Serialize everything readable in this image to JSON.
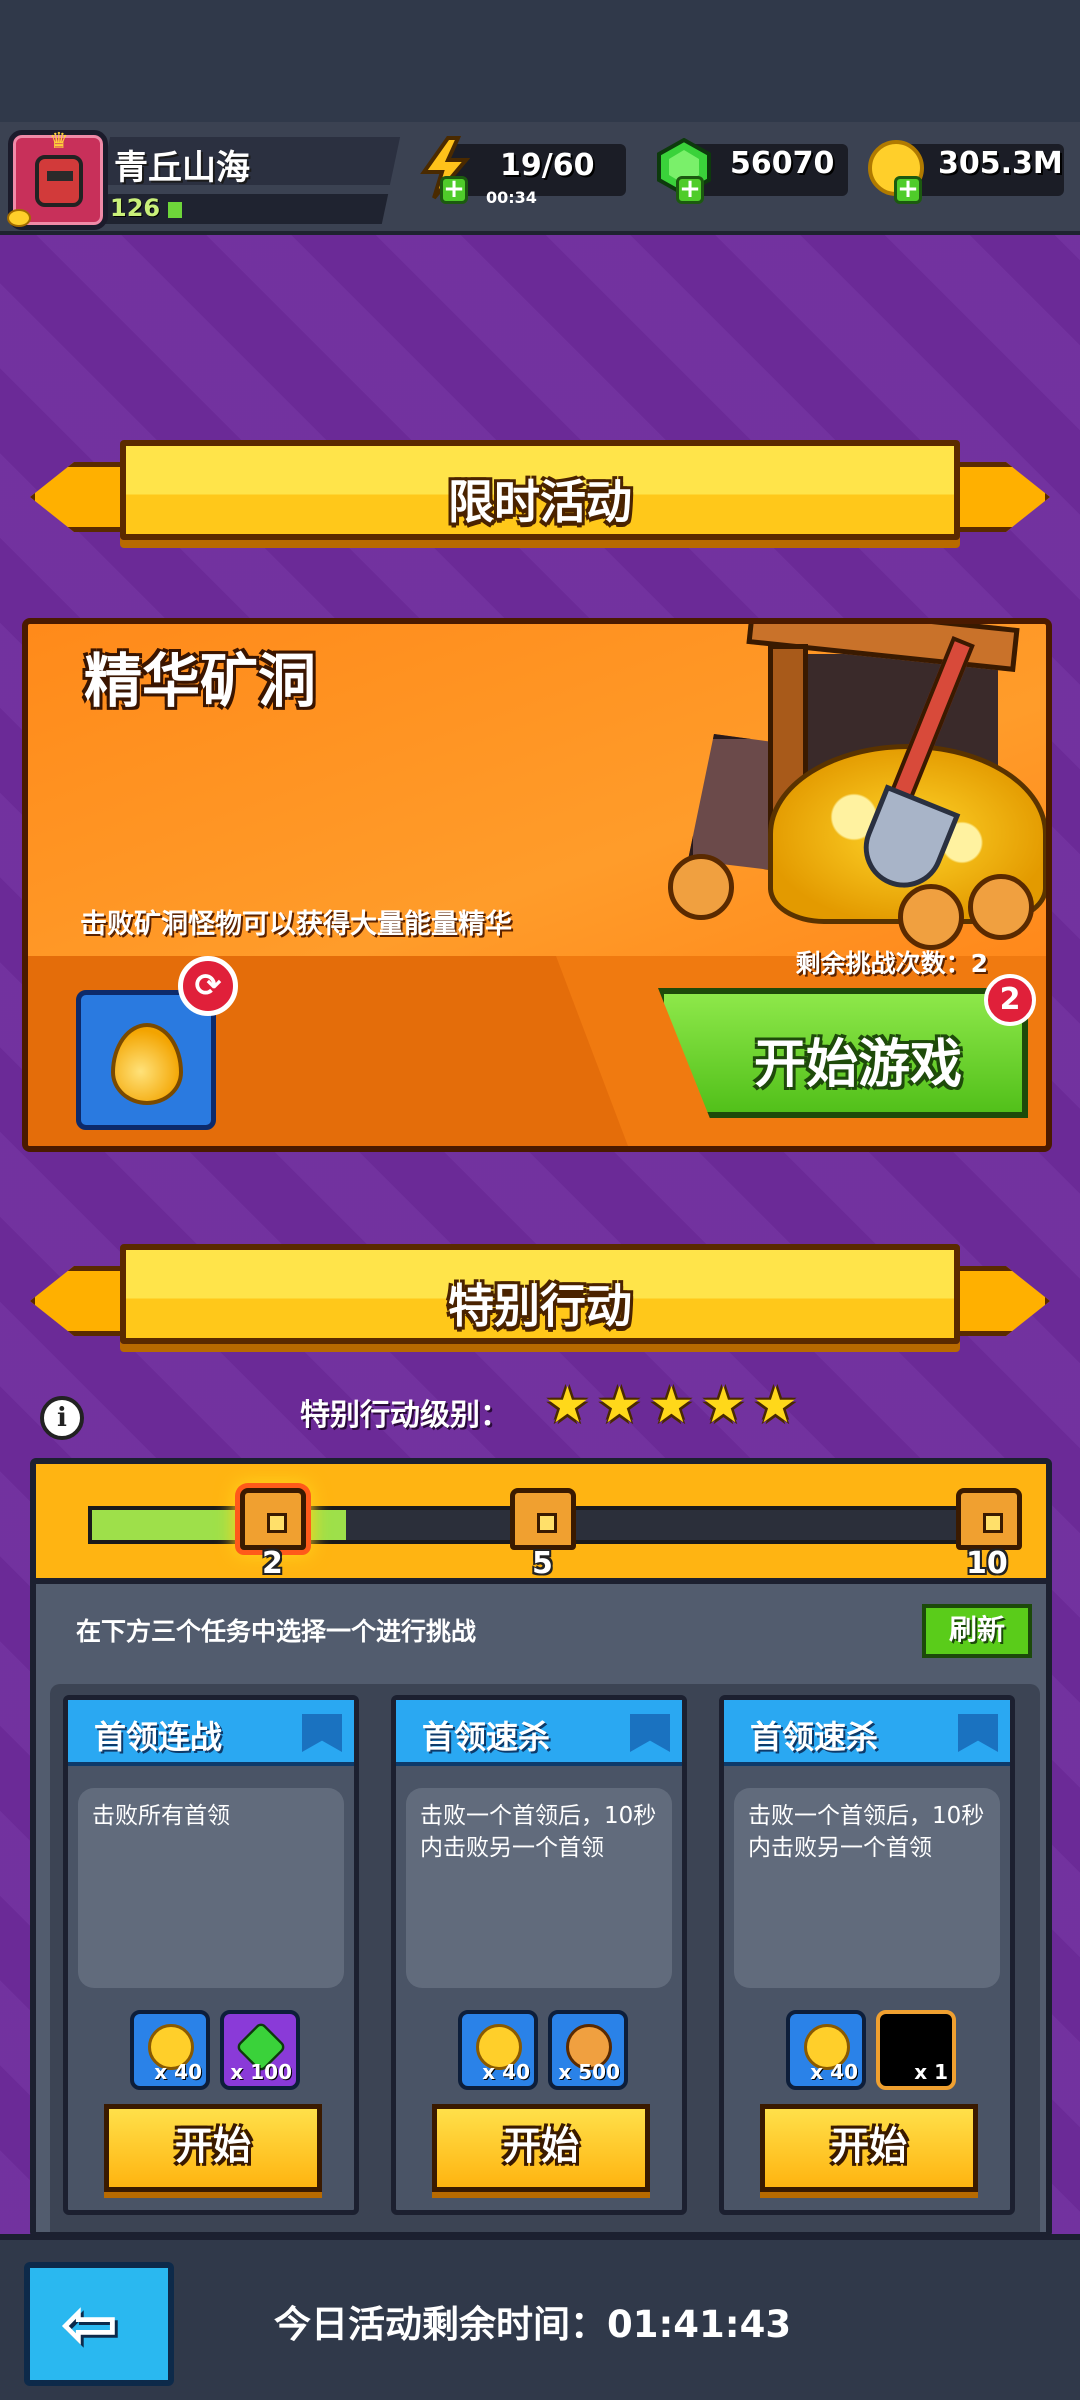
{
  "player": {
    "name": "青丘山海",
    "level": "126"
  },
  "resources": {
    "energy": "19/60",
    "energy_timer": "00:34",
    "gems": "56070",
    "coins": "305.3M"
  },
  "limited_event": {
    "banner": "限时活动",
    "title": "精华矿洞",
    "description": "击败矿洞怪物可以获得大量能量精华",
    "remaining_label": "剩余挑战次数：2",
    "start_button": "开始游戏",
    "badge_count": "2",
    "drop_icon": "essence-drop-icon"
  },
  "special_action": {
    "banner": "特别行动",
    "level_label": "特别行动级别：",
    "stars": 5,
    "progress": {
      "fill_fraction": 0.28,
      "milestones": [
        "2",
        "5",
        "10"
      ]
    },
    "instruction": "在下方三个任务中选择一个进行挑战",
    "refresh_button": "刷新",
    "tasks": [
      {
        "title": "首领连战",
        "description": "击败所有首领",
        "rewards": [
          {
            "icon": "coin-icon",
            "qty": "x 40"
          },
          {
            "icon": "gem-icon",
            "qty": "x 100"
          }
        ],
        "button": "开始"
      },
      {
        "title": "首领速杀",
        "description": "击败一个首领后，10秒内击败另一个首领",
        "rewards": [
          {
            "icon": "coin-icon",
            "qty": "x 40"
          },
          {
            "icon": "lion-token-icon",
            "qty": "x 500"
          }
        ],
        "button": "开始"
      },
      {
        "title": "首领速杀",
        "description": "击败一个首领后，10秒内击败另一个首领",
        "rewards": [
          {
            "icon": "coin-icon",
            "qty": "x 40"
          },
          {
            "icon": "mystery-item-icon",
            "qty": "x 1"
          }
        ],
        "button": "开始"
      }
    ]
  },
  "footer": {
    "remaining_time": "今日活动剩余时间：01:41:43"
  },
  "colors": {
    "background": "#6e2b9c",
    "banner_yellow": "#ffc81a",
    "event_orange": "#ff8a1a",
    "start_green": "#52c01a",
    "task_blue": "#2aa8f2"
  }
}
